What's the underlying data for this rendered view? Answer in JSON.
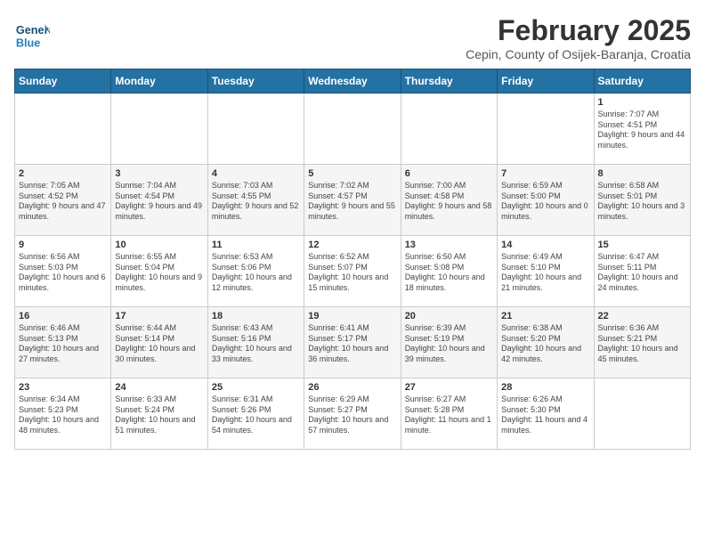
{
  "logo": {
    "line1": "General",
    "line2": "Blue"
  },
  "header": {
    "month_year": "February 2025",
    "location": "Cepin, County of Osijek-Baranja, Croatia"
  },
  "weekdays": [
    "Sunday",
    "Monday",
    "Tuesday",
    "Wednesday",
    "Thursday",
    "Friday",
    "Saturday"
  ],
  "weeks": [
    [
      {
        "day": "",
        "info": ""
      },
      {
        "day": "",
        "info": ""
      },
      {
        "day": "",
        "info": ""
      },
      {
        "day": "",
        "info": ""
      },
      {
        "day": "",
        "info": ""
      },
      {
        "day": "",
        "info": ""
      },
      {
        "day": "1",
        "info": "Sunrise: 7:07 AM\nSunset: 4:51 PM\nDaylight: 9 hours and 44 minutes."
      }
    ],
    [
      {
        "day": "2",
        "info": "Sunrise: 7:05 AM\nSunset: 4:52 PM\nDaylight: 9 hours and 47 minutes."
      },
      {
        "day": "3",
        "info": "Sunrise: 7:04 AM\nSunset: 4:54 PM\nDaylight: 9 hours and 49 minutes."
      },
      {
        "day": "4",
        "info": "Sunrise: 7:03 AM\nSunset: 4:55 PM\nDaylight: 9 hours and 52 minutes."
      },
      {
        "day": "5",
        "info": "Sunrise: 7:02 AM\nSunset: 4:57 PM\nDaylight: 9 hours and 55 minutes."
      },
      {
        "day": "6",
        "info": "Sunrise: 7:00 AM\nSunset: 4:58 PM\nDaylight: 9 hours and 58 minutes."
      },
      {
        "day": "7",
        "info": "Sunrise: 6:59 AM\nSunset: 5:00 PM\nDaylight: 10 hours and 0 minutes."
      },
      {
        "day": "8",
        "info": "Sunrise: 6:58 AM\nSunset: 5:01 PM\nDaylight: 10 hours and 3 minutes."
      }
    ],
    [
      {
        "day": "9",
        "info": "Sunrise: 6:56 AM\nSunset: 5:03 PM\nDaylight: 10 hours and 6 minutes."
      },
      {
        "day": "10",
        "info": "Sunrise: 6:55 AM\nSunset: 5:04 PM\nDaylight: 10 hours and 9 minutes."
      },
      {
        "day": "11",
        "info": "Sunrise: 6:53 AM\nSunset: 5:06 PM\nDaylight: 10 hours and 12 minutes."
      },
      {
        "day": "12",
        "info": "Sunrise: 6:52 AM\nSunset: 5:07 PM\nDaylight: 10 hours and 15 minutes."
      },
      {
        "day": "13",
        "info": "Sunrise: 6:50 AM\nSunset: 5:08 PM\nDaylight: 10 hours and 18 minutes."
      },
      {
        "day": "14",
        "info": "Sunrise: 6:49 AM\nSunset: 5:10 PM\nDaylight: 10 hours and 21 minutes."
      },
      {
        "day": "15",
        "info": "Sunrise: 6:47 AM\nSunset: 5:11 PM\nDaylight: 10 hours and 24 minutes."
      }
    ],
    [
      {
        "day": "16",
        "info": "Sunrise: 6:46 AM\nSunset: 5:13 PM\nDaylight: 10 hours and 27 minutes."
      },
      {
        "day": "17",
        "info": "Sunrise: 6:44 AM\nSunset: 5:14 PM\nDaylight: 10 hours and 30 minutes."
      },
      {
        "day": "18",
        "info": "Sunrise: 6:43 AM\nSunset: 5:16 PM\nDaylight: 10 hours and 33 minutes."
      },
      {
        "day": "19",
        "info": "Sunrise: 6:41 AM\nSunset: 5:17 PM\nDaylight: 10 hours and 36 minutes."
      },
      {
        "day": "20",
        "info": "Sunrise: 6:39 AM\nSunset: 5:19 PM\nDaylight: 10 hours and 39 minutes."
      },
      {
        "day": "21",
        "info": "Sunrise: 6:38 AM\nSunset: 5:20 PM\nDaylight: 10 hours and 42 minutes."
      },
      {
        "day": "22",
        "info": "Sunrise: 6:36 AM\nSunset: 5:21 PM\nDaylight: 10 hours and 45 minutes."
      }
    ],
    [
      {
        "day": "23",
        "info": "Sunrise: 6:34 AM\nSunset: 5:23 PM\nDaylight: 10 hours and 48 minutes."
      },
      {
        "day": "24",
        "info": "Sunrise: 6:33 AM\nSunset: 5:24 PM\nDaylight: 10 hours and 51 minutes."
      },
      {
        "day": "25",
        "info": "Sunrise: 6:31 AM\nSunset: 5:26 PM\nDaylight: 10 hours and 54 minutes."
      },
      {
        "day": "26",
        "info": "Sunrise: 6:29 AM\nSunset: 5:27 PM\nDaylight: 10 hours and 57 minutes."
      },
      {
        "day": "27",
        "info": "Sunrise: 6:27 AM\nSunset: 5:28 PM\nDaylight: 11 hours and 1 minute."
      },
      {
        "day": "28",
        "info": "Sunrise: 6:26 AM\nSunset: 5:30 PM\nDaylight: 11 hours and 4 minutes."
      },
      {
        "day": "",
        "info": ""
      }
    ]
  ]
}
